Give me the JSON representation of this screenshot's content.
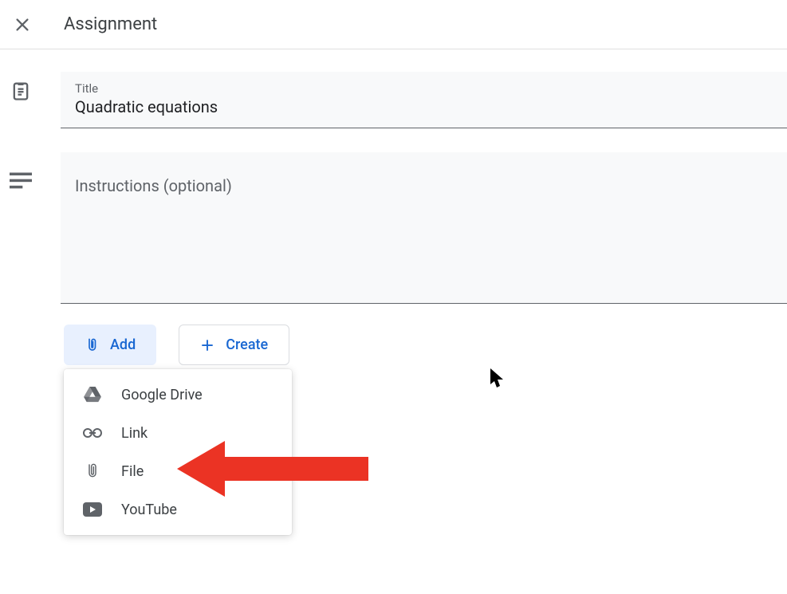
{
  "header": {
    "title": "Assignment"
  },
  "title_field": {
    "label": "Title",
    "value": "Quadratic equations"
  },
  "instructions_field": {
    "placeholder": "Instructions (optional)",
    "value": ""
  },
  "buttons": {
    "add": "Add",
    "create": "Create"
  },
  "add_menu": {
    "items": [
      {
        "label": "Google Drive"
      },
      {
        "label": "Link"
      },
      {
        "label": "File"
      },
      {
        "label": "YouTube"
      }
    ]
  }
}
